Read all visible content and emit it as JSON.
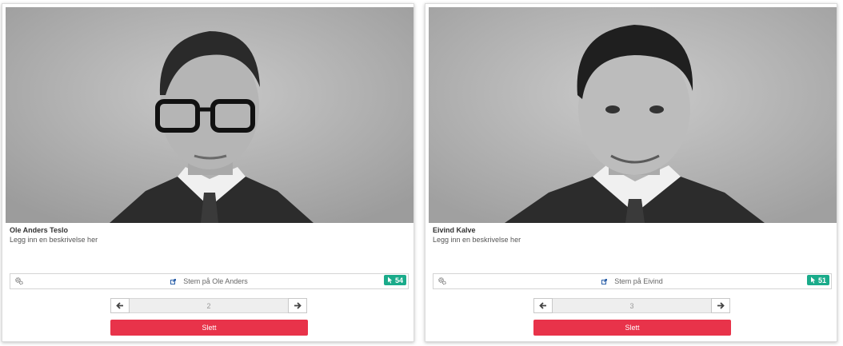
{
  "candidates": [
    {
      "name": "Ole Anders Teslo",
      "description": "Legg inn en beskrivelse her",
      "vote_label": "Stem på Ole Anders",
      "vote_count": "54",
      "page_number": "2",
      "delete_label": "Slett",
      "photo_icon": "portrait-photo"
    },
    {
      "name": "Eivind Kalve",
      "description": "Legg inn en beskrivelse her",
      "vote_label": "Stem på Eivind",
      "vote_count": "51",
      "page_number": "3",
      "delete_label": "Slett",
      "photo_icon": "portrait-photo"
    }
  ],
  "icons": {
    "settings": "gears-icon",
    "vote": "external-link-icon",
    "count": "cursor-pointer-icon",
    "prev": "arrow-left-icon",
    "next": "arrow-right-icon"
  },
  "colors": {
    "badge": "#1aab8a",
    "delete": "#e8334a"
  }
}
